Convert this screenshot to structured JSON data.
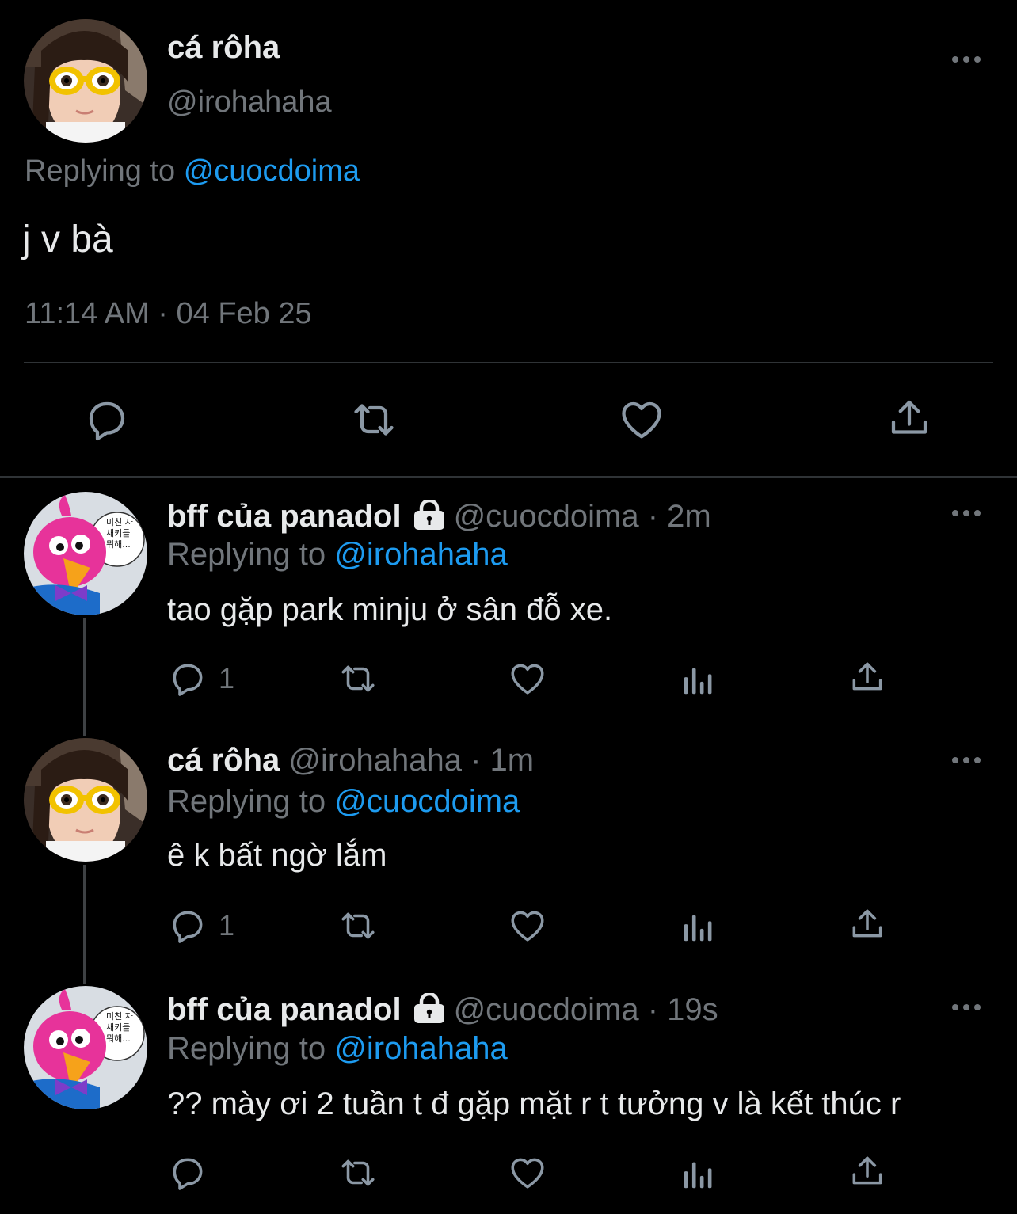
{
  "main_tweet": {
    "author_name": "cá rôha",
    "author_handle": "@irohahaha",
    "replying_prefix": "Replying to",
    "replying_to": "@cuocdoima",
    "text": "j v bà",
    "timestamp": "11:14 AM · 04 Feb 25",
    "actions": [
      "reply-icon",
      "retweet-icon",
      "like-icon",
      "share-icon"
    ]
  },
  "replies": [
    {
      "author_name": "bff của panadol",
      "locked": true,
      "author_handle": "@cuocdoima",
      "time": "· 2m",
      "replying_prefix": "Replying to",
      "replying_to": "@irohahaha",
      "text": "tao gặp park minju ở sân đỗ xe.",
      "reply_count": "1",
      "avatar_speech_text": "미친 자\n새키들\n뭐해..."
    },
    {
      "author_name": "cá rôha",
      "locked": false,
      "author_handle": "@irohahaha",
      "time": "· 1m",
      "replying_prefix": "Replying to",
      "replying_to": "@cuocdoima",
      "text": "ê k bất ngờ lắm",
      "reply_count": "1"
    },
    {
      "author_name": "bff của panadol",
      "locked": true,
      "author_handle": "@cuocdoima",
      "time": "· 19s",
      "replying_prefix": "Replying to",
      "replying_to": "@irohahaha",
      "text": "?? mày ơi 2 tuần t đ gặp mặt r t tưởng v là kết thúc r",
      "reply_count": "",
      "avatar_speech_text": "미친 자\n새키들\n뭐해..."
    }
  ],
  "colors": {
    "background": "#000000",
    "text": "#e7e9ea",
    "secondary": "#71767b",
    "link": "#1d9bf0",
    "divider": "#2f3336"
  }
}
